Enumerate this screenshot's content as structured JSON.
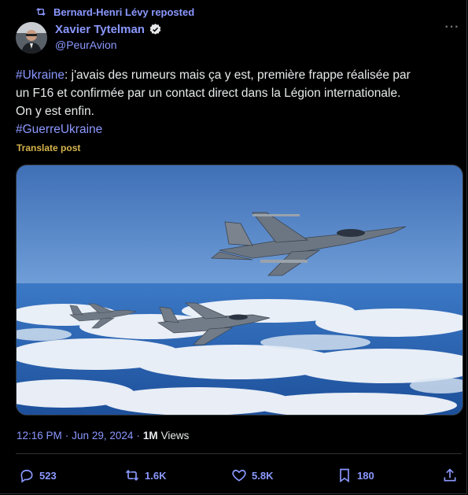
{
  "repost": {
    "label": "Bernard-Henri Lévy reposted"
  },
  "author": {
    "name": "Xavier Tytelman",
    "handle": "@PeurAvion"
  },
  "tweet": {
    "tag1": "#Ukraine",
    "line1_rest": ": j'avais des rumeurs mais ça y est, première frappe réalisée par",
    "line2": "un F16 et confirmée par un contact direct dans la Légion internationale.",
    "line3": "On y est enfin.",
    "tag2": "#GuerreUkraine"
  },
  "translate_label": "Translate post",
  "meta": {
    "time": "12:16 PM",
    "separator1": "·",
    "date": "Jun 29, 2024",
    "separator2": "·",
    "views_count": "1M",
    "views_label": "Views"
  },
  "actions": {
    "replies": "523",
    "reposts": "1.6K",
    "likes": "5.8K",
    "bookmarks": "180"
  },
  "colors": {
    "accent": "#8b98ff",
    "text": "#e7e9ea",
    "muted": "#71767b",
    "translate": "#d5b44a",
    "background": "#000000"
  },
  "icons": {
    "repost": "repost-icon",
    "verified": "verified-badge-icon",
    "more": "more-icon",
    "reply": "reply-icon",
    "like": "heart-icon",
    "bookmark": "bookmark-icon",
    "share": "share-icon"
  }
}
